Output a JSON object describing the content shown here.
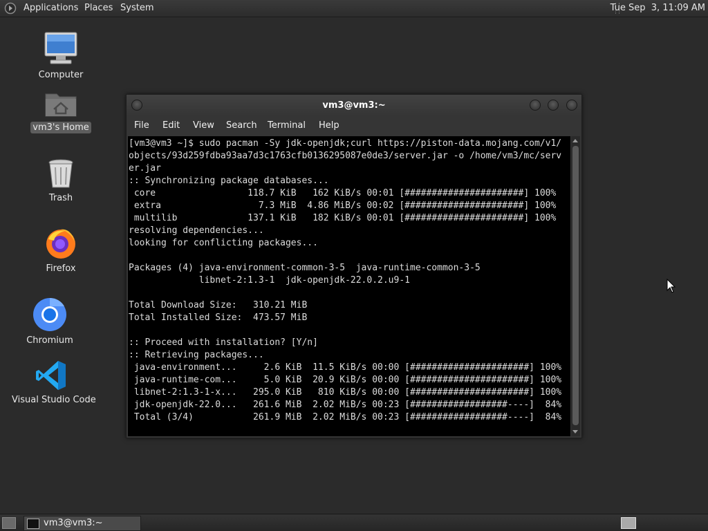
{
  "top_panel": {
    "menus": [
      "Applications",
      "Places",
      "System"
    ],
    "clock": "Tue Sep  3, 11:09 AM",
    "launcher_icon": "gnome-foot-icon"
  },
  "desktop": {
    "icons": [
      {
        "label": "Computer",
        "icon": "computer-monitor-icon"
      },
      {
        "label": "vm3's Home",
        "icon": "home-folder-icon"
      },
      {
        "label": "Trash",
        "icon": "trash-can-icon"
      },
      {
        "label": "Firefox",
        "icon": "firefox-icon"
      },
      {
        "label": "Chromium",
        "icon": "chromium-icon"
      },
      {
        "label": "Visual Studio Code",
        "icon": "vscode-icon"
      }
    ]
  },
  "terminal": {
    "title": "vm3@vm3:~",
    "menu": [
      "File",
      "Edit",
      "View",
      "Search",
      "Terminal",
      "Help"
    ],
    "lines": [
      "[vm3@vm3 ~]$ sudo pacman -Sy jdk-openjdk;curl https://piston-data.mojang.com/v1/",
      "objects/93d259fdba93aa7d3c1763cfb0136295087e0de3/server.jar -o /home/vm3/mc/serv",
      "er.jar",
      ":: Synchronizing package databases...",
      " core                 118.7 KiB   162 KiB/s 00:01 [######################] 100%",
      " extra                  7.3 MiB  4.86 MiB/s 00:02 [######################] 100%",
      " multilib             137.1 KiB   182 KiB/s 00:01 [######################] 100%",
      "resolving dependencies...",
      "looking for conflicting packages...",
      "",
      "Packages (4) java-environment-common-3-5  java-runtime-common-3-5",
      "             libnet-2:1.3-1  jdk-openjdk-22.0.2.u9-1",
      "",
      "Total Download Size:   310.21 MiB",
      "Total Installed Size:  473.57 MiB",
      "",
      ":: Proceed with installation? [Y/n]",
      ":: Retrieving packages...",
      " java-environment...     2.6 KiB  11.5 KiB/s 00:00 [######################] 100%",
      " java-runtime-com...     5.0 KiB  20.9 KiB/s 00:00 [######################] 100%",
      " libnet-2:1.3-1-x...   295.0 KiB   810 KiB/s 00:00 [######################] 100%",
      " jdk-openjdk-22.0...   261.6 MiB  2.02 MiB/s 00:23 [##################----]  84%",
      " Total (3/4)           261.9 MiB  2.02 MiB/s 00:23 [##################----]  84%"
    ]
  },
  "bottom_panel": {
    "task_label": "vm3@vm3:~"
  },
  "colors": {
    "desktop_bg": "#2b2b2b",
    "panel_bg": "#333333",
    "terminal_bg": "#000000",
    "terminal_fg": "#dcdcdc"
  }
}
